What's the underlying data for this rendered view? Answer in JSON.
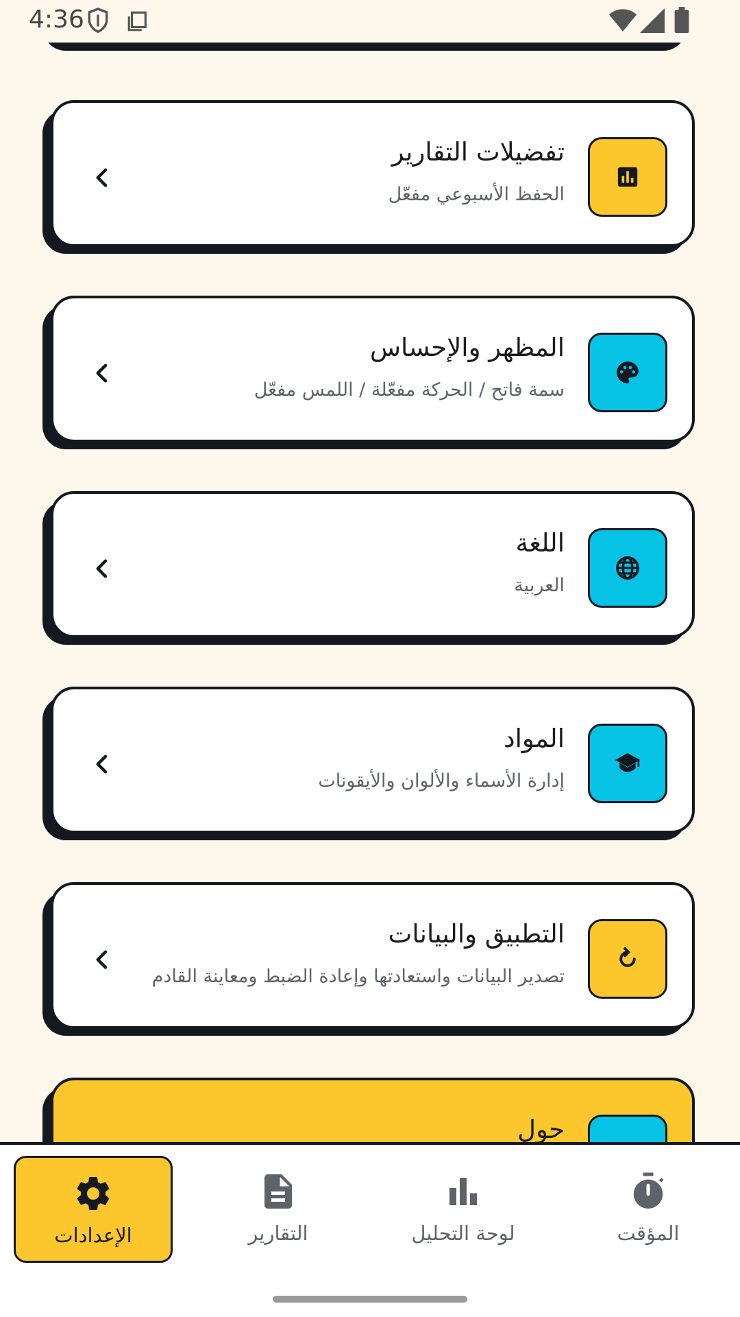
{
  "status_bar": {
    "time": "4:36",
    "icons": [
      "shield-icon",
      "clipboard-icon",
      "wifi-icon",
      "signal-icon",
      "battery-icon"
    ]
  },
  "settings": [
    {
      "title": "تفضيلات التقارير",
      "subtitle": "الحفظ الأسبوعي مفعّل",
      "icon": "bar-chart-icon",
      "tile_color": "#FCC72C"
    },
    {
      "title": "المظهر والإحساس",
      "subtitle": "سمة فاتح / الحركة مفعّلة / اللمس مفعّل",
      "icon": "palette-icon",
      "tile_color": "#06C3E6"
    },
    {
      "title": "اللغة",
      "subtitle": "العربية",
      "icon": "globe-icon",
      "tile_color": "#06C3E6"
    },
    {
      "title": "المواد",
      "subtitle": "إدارة الأسماء والألوان والأيقونات",
      "icon": "graduation-cap-icon",
      "tile_color": "#06C3E6"
    },
    {
      "title": "التطبيق والبيانات",
      "subtitle": "تصدير البيانات واستعادتها وإعادة الضبط ومعاينة القادم",
      "icon": "restore-icon",
      "tile_color": "#FCC72C"
    },
    {
      "title": "حول",
      "icon": "info-icon",
      "tile_color": "#06C3E6",
      "card_color": "#FCC72C"
    }
  ],
  "bottom_nav": {
    "items": [
      {
        "label": "الإعدادات",
        "icon": "gear-icon",
        "active": true
      },
      {
        "label": "التقارير",
        "icon": "document-icon",
        "active": false
      },
      {
        "label": "لوحة التحليل",
        "icon": "bar-chart-icon",
        "active": false
      },
      {
        "label": "المؤقت",
        "icon": "stopwatch-icon",
        "active": false
      }
    ]
  },
  "colors": {
    "background": "#FEF7EB",
    "accent_yellow": "#FCC72C",
    "accent_cyan": "#06C3E6",
    "outline": "#14181F"
  }
}
